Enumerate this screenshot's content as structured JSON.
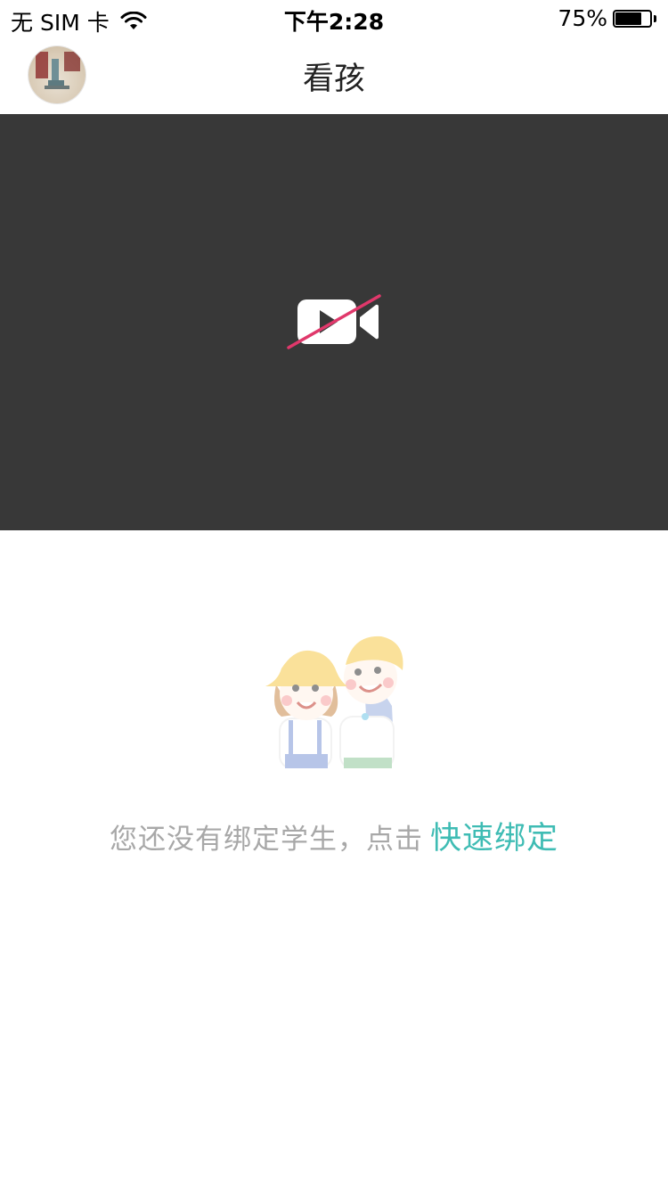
{
  "status_bar": {
    "carrier": "无 SIM 卡",
    "time": "下午2:28",
    "battery_percent": "75%",
    "battery_level": 0.75
  },
  "nav": {
    "title": "看孩"
  },
  "video": {
    "state_icon": "video-off-icon",
    "background_color": "#383838",
    "slash_color": "#e0386b"
  },
  "empty_state": {
    "message": "您还没有绑定学生，点击",
    "link_label": "快速绑定",
    "link_color": "#3fbcb4"
  }
}
